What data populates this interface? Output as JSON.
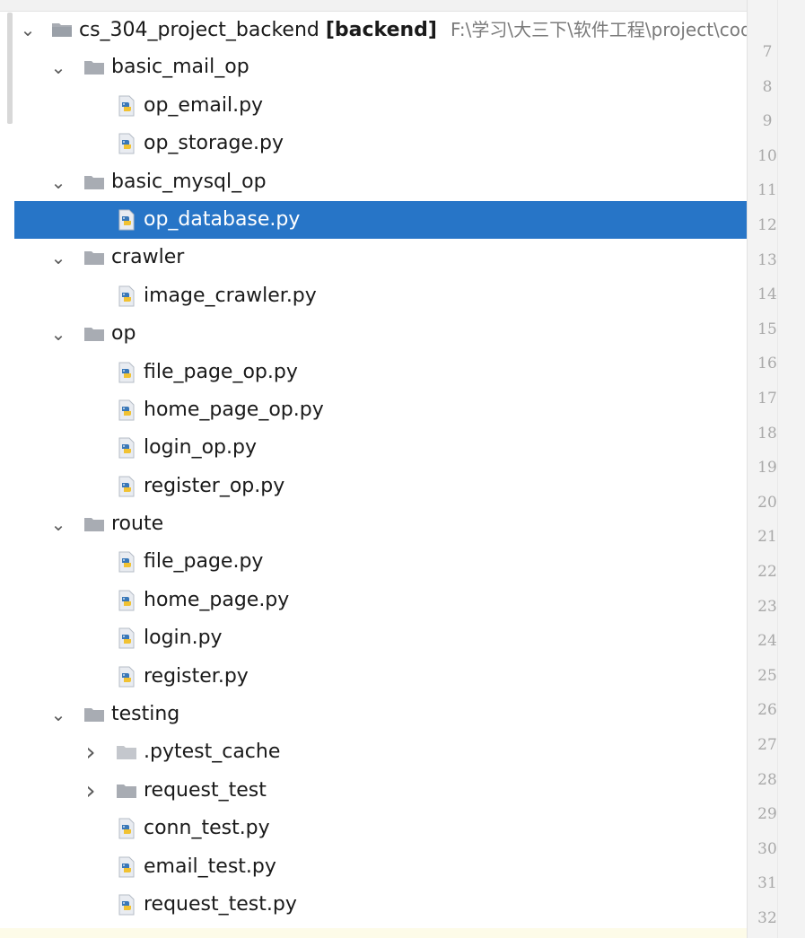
{
  "project": {
    "name": "cs_304_project_backend",
    "module": "[backend]",
    "path": "F:\\学习\\大三下\\软件工程\\project\\cod"
  },
  "tree": [
    {
      "kind": "folder",
      "depth": 1,
      "expanded": true,
      "label": "basic_mail_op"
    },
    {
      "kind": "file",
      "depth": 2,
      "label": "op_email.py"
    },
    {
      "kind": "file",
      "depth": 2,
      "label": "op_storage.py"
    },
    {
      "kind": "folder",
      "depth": 1,
      "expanded": true,
      "label": "basic_mysql_op"
    },
    {
      "kind": "file",
      "depth": 2,
      "label": "op_database.py",
      "selected": true
    },
    {
      "kind": "folder",
      "depth": 1,
      "expanded": true,
      "label": "crawler"
    },
    {
      "kind": "file",
      "depth": 2,
      "label": "image_crawler.py"
    },
    {
      "kind": "folder",
      "depth": 1,
      "expanded": true,
      "label": "op"
    },
    {
      "kind": "file",
      "depth": 2,
      "label": "file_page_op.py"
    },
    {
      "kind": "file",
      "depth": 2,
      "label": "home_page_op.py"
    },
    {
      "kind": "file",
      "depth": 2,
      "label": "login_op.py"
    },
    {
      "kind": "file",
      "depth": 2,
      "label": "register_op.py"
    },
    {
      "kind": "folder",
      "depth": 1,
      "expanded": true,
      "label": "route"
    },
    {
      "kind": "file",
      "depth": 2,
      "label": "file_page.py"
    },
    {
      "kind": "file",
      "depth": 2,
      "label": "home_page.py"
    },
    {
      "kind": "file",
      "depth": 2,
      "label": "login.py"
    },
    {
      "kind": "file",
      "depth": 2,
      "label": "register.py"
    },
    {
      "kind": "folder",
      "depth": 1,
      "expanded": true,
      "label": "testing"
    },
    {
      "kind": "folder",
      "depth": 2,
      "expanded": false,
      "label": ".pytest_cache",
      "excluded": true
    },
    {
      "kind": "folder",
      "depth": 2,
      "expanded": false,
      "label": "request_test"
    },
    {
      "kind": "file",
      "depth": 2,
      "label": "conn_test.py"
    },
    {
      "kind": "file",
      "depth": 2,
      "label": "email_test.py"
    },
    {
      "kind": "file",
      "depth": 2,
      "label": "request_test.py"
    }
  ],
  "line_numbers": [
    "7",
    "8",
    "9",
    "10",
    "11",
    "12",
    "13",
    "14",
    "15",
    "16",
    "17",
    "18",
    "19",
    "20",
    "21",
    "22",
    "23",
    "24",
    "25",
    "26",
    "27",
    "28",
    "29",
    "30",
    "31",
    "32"
  ],
  "colors": {
    "selection": "#2775c7",
    "folder": "#a8acb3",
    "python_blue": "#3a78b8",
    "python_yellow": "#f1c232"
  }
}
